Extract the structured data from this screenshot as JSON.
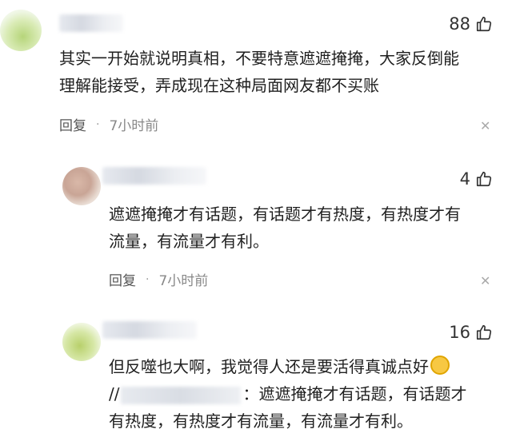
{
  "comments": [
    {
      "likes": "88",
      "text": "其实一开始就说明真相，不要特意遮遮掩掩，大家反倒能\n理解能接受，弄成现在这种局面网友都不买账",
      "reply_label": "回复",
      "separator": "·",
      "time": "7小时前"
    },
    {
      "likes": "4",
      "text": "遮遮掩掩才有话题，有话题才有热度，有热度才有\n流量，有流量才有利。",
      "reply_label": "回复",
      "separator": "·",
      "time": "7小时前"
    },
    {
      "likes": "16",
      "text_line1": "但反噬也大啊，我觉得人还是要活得真诚点好",
      "text_line2_prefix": "//",
      "text_line2_suffix": "：遮遮掩掩才有话题，有话题才",
      "text_line3": "有热度，有热度才有流量，有流量才有利。"
    }
  ],
  "icons": {
    "thumb": "thumb-up-icon",
    "close": "close-icon",
    "emoji": "grin-emoji-icon"
  },
  "colors": {
    "text": "#1f1f1f",
    "meta": "#888888",
    "close": "#aaaaaa"
  }
}
